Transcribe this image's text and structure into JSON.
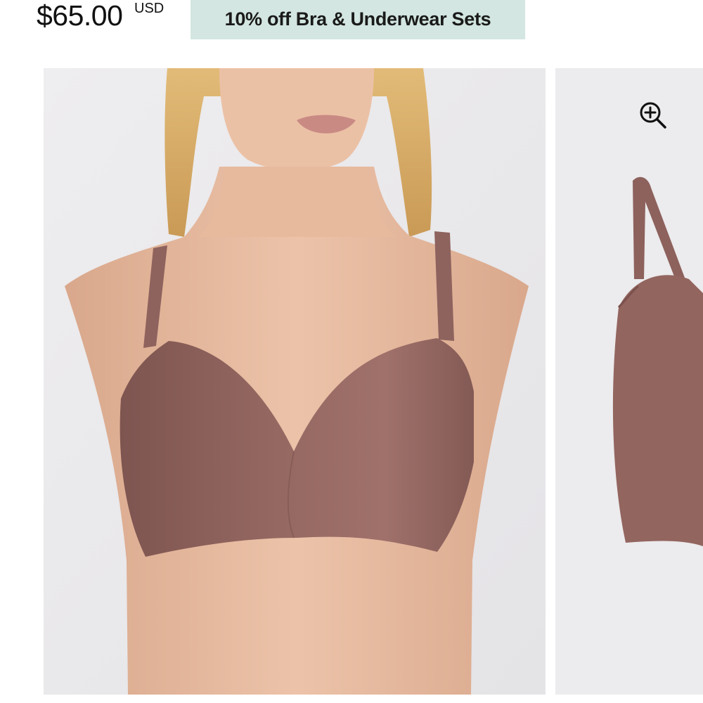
{
  "product": {
    "price": "$65.00",
    "currency": "USD",
    "promo": "10% off Bra & Underwear Sets"
  },
  "gallery": {
    "main_image": "model-wearing-bra-photo",
    "side_image": "bra-product-photo",
    "zoom_icon": "zoom-in-icon"
  },
  "colors": {
    "promo_background": "#d3e6e1",
    "bra_color": "#93655f",
    "skin": "#e6bba1",
    "hair": "#ddb46f",
    "image_background": "#ecebed"
  }
}
